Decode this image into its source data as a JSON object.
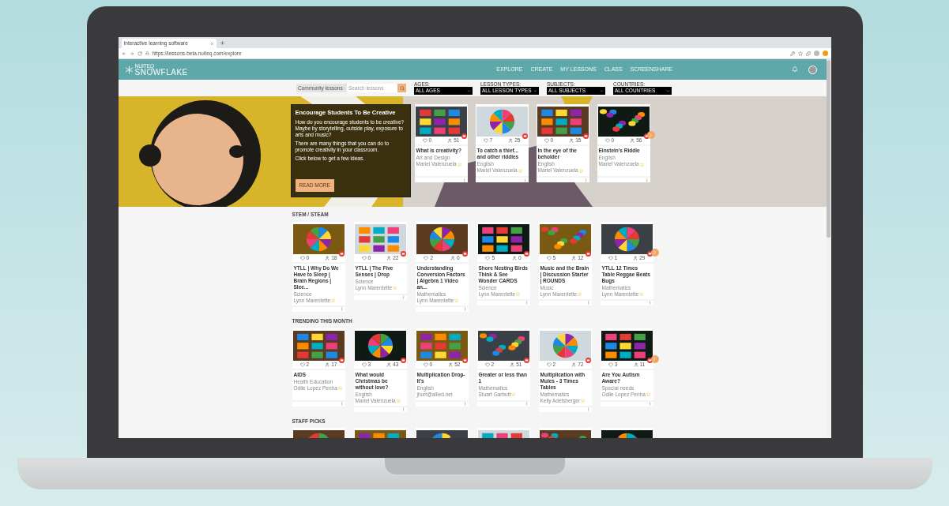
{
  "browser": {
    "tab_title": "Interactive learning software",
    "url": "https://lessons-beta.nuiteq.com/explore"
  },
  "nav": {
    "logo_small": "NUITEQ",
    "logo": "SNOWFLAKE",
    "items": [
      {
        "label": "EXPLORE",
        "selected": false
      },
      {
        "label": "CREATE",
        "selected": false
      },
      {
        "label": "MY LESSONS",
        "selected": false
      },
      {
        "label": "CLASS",
        "selected": false
      },
      {
        "label": "SCREENSHARE",
        "selected": false
      }
    ]
  },
  "filters": {
    "source": "Community lessons",
    "search_placeholder": "Search lessons",
    "dropdowns": [
      {
        "label": "AGES:",
        "value": "ALL AGES"
      },
      {
        "label": "LESSON TYPES:",
        "value": "ALL LESSON TYPES"
      },
      {
        "label": "SUBJECTS:",
        "value": "ALL SUBJECTS"
      },
      {
        "label": "COUNTRIES:",
        "value": "ALL COUNTRIES"
      }
    ]
  },
  "hero": {
    "title": "Encourage Students To Be Creative",
    "paragraphs": [
      "How do you encourage students to be creative? Maybe by storytelling, outside play, exposure to arts and music?",
      "There are many things that you can do to promote creativity in your classroom.",
      "Click below to get a few ideas."
    ],
    "button": "READ MORE",
    "lessons": [
      {
        "kind": "lesson",
        "likes": "0",
        "downloads": "51",
        "title": "What is creativity?",
        "subject": "Art and Design",
        "author": "Mariel Valenzuela",
        "verified": true
      },
      {
        "kind": "lesson",
        "likes": "7",
        "downloads": "25",
        "title": "To catch a thief... and other riddles",
        "subject": "English",
        "author": "Mariel Valenzuela",
        "verified": true
      },
      {
        "kind": "lesson",
        "likes": "0",
        "downloads": "15",
        "title": "In the eye of the beholder",
        "subject": "English",
        "author": "Mariel Valenzuela",
        "verified": true
      },
      {
        "kind": "lesson",
        "likes": "0",
        "downloads": "56",
        "title": "Einstein's Riddle",
        "subject": "English",
        "author": "Mariel Valenzuela",
        "verified": true
      }
    ]
  },
  "sections": [
    {
      "title": "STEM / STEAM",
      "lessons": [
        {
          "kind": "lesson",
          "likes": "0",
          "downloads": "18",
          "title": "YTLL | Why Do We Have to Sleep | Brain Regions | Slee...",
          "subject": "Science",
          "author": "Lynn Marentette",
          "verified": true
        },
        {
          "kind": "lesson",
          "likes": "0",
          "downloads": "22",
          "title": "YTLL | The Five Senses | Drop",
          "subject": "Science",
          "author": "Lynn Marentette",
          "verified": true
        },
        {
          "kind": "lesson",
          "likes": "2",
          "downloads": "0",
          "title": "Understanding Conversion Factors | Algebra 1 Video an...",
          "subject": "Mathematics",
          "author": "Lynn Marentette",
          "verified": true
        },
        {
          "kind": "lesson",
          "likes": "5",
          "downloads": "0",
          "title": "Shore Nesting Birds Think & See Wonder CARDS",
          "subject": "Science",
          "author": "Lynn Marentette",
          "verified": true
        },
        {
          "kind": "lesson",
          "likes": "5",
          "downloads": "12",
          "title": "Music and the Brain | Discussion Starter | ROUNDS",
          "subject": "Music",
          "author": "Lynn Marentette",
          "verified": true
        },
        {
          "kind": "lesson",
          "likes": "1",
          "downloads": "29",
          "title": "YTLL 12 Times Table Reggae Beats Bugs",
          "subject": "Mathematics",
          "author": "Lynn Marentette",
          "verified": true
        }
      ]
    },
    {
      "title": "TRENDING THIS MONTH",
      "lessons": [
        {
          "kind": "lesson",
          "likes": "2",
          "downloads": "17",
          "title": "AIDS",
          "subject": "Health Education",
          "author": "Odile Lopez Penha",
          "verified": true
        },
        {
          "kind": "lesson",
          "likes": "3",
          "downloads": "43",
          "title": "What would Christmas be without love?",
          "subject": "English",
          "author": "Mariel Valenzuela",
          "verified": true
        },
        {
          "kind": "lesson",
          "likes": "0",
          "downloads": "52",
          "title": "Multiplication Drop-It's",
          "subject": "English",
          "author": "jhurt@allied.net",
          "verified": false
        },
        {
          "kind": "lesson",
          "likes": "2",
          "downloads": "51",
          "title": "Greater or less than 1",
          "subject": "Mathematics",
          "author": "Stuart Garbutt",
          "verified": true
        },
        {
          "kind": "lesson",
          "likes": "2",
          "downloads": "72",
          "title": "Multiplication with Mules - 3 Times Tables",
          "subject": "Mathematics",
          "author": "Kelly Adelsberger",
          "verified": true
        },
        {
          "kind": "lesson",
          "likes": "3",
          "downloads": "11",
          "title": "Are You Autism Aware?",
          "subject": "Special needs",
          "author": "Odile Lopez Penha",
          "verified": true
        }
      ]
    },
    {
      "title": "STAFF PICKS"
    }
  ]
}
